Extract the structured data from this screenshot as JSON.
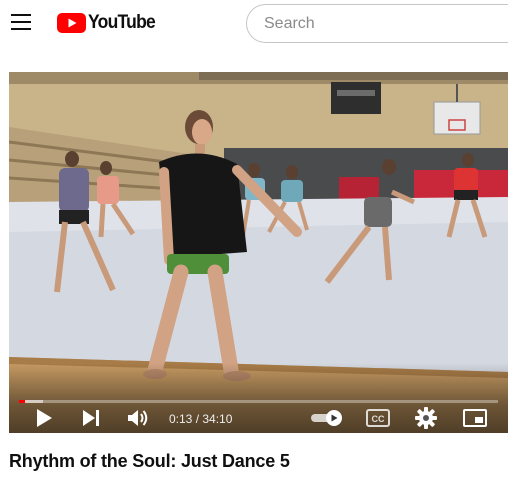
{
  "header": {
    "logo_text": "YouTube",
    "search_placeholder": "Search"
  },
  "player": {
    "current_time": "0:13",
    "duration": "34:10",
    "time_display": "0:13 / 34:10",
    "progress_played_fraction": 0.0063,
    "progress_loaded_fraction": 0.05,
    "autoplay": true,
    "controls": [
      "play-icon",
      "next-icon",
      "volume-icon",
      "autoplay-toggle",
      "captions-icon",
      "settings-icon",
      "miniplayer-icon"
    ],
    "captions_label": "CC"
  },
  "video": {
    "title": "Rhythm of the Soul: Just Dance 5"
  },
  "colors": {
    "brand_red": "#ff0000",
    "text": "#0f0f0f",
    "floor": "#dde0e7"
  }
}
